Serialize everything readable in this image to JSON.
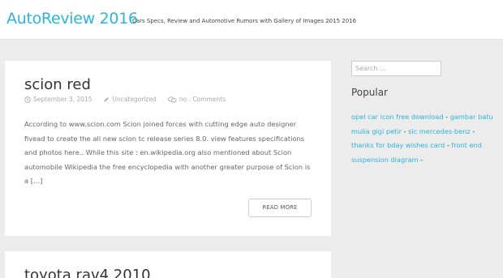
{
  "header": {
    "site_title": "AutoReview 2016",
    "tagline": "Cars Specs, Review and Automotive Rumors with Gallery of Images 2015 2016"
  },
  "posts": [
    {
      "title": "scion red",
      "date": "September 3, 2015",
      "category": "Uncategorized",
      "comments": "no . Comments",
      "excerpt": "According to www.scion.com Scion joined forces with cutting edge auto designer fivead to create the all new scion tc release series 8.0. view features specifications and photos here.. While this site : en.wikipedia.org also mentioned about Scion automobile Wikipedia the free encyclopedia with another greater purpose of Scion is a […]",
      "read_more": "READ MORE"
    },
    {
      "title": "toyota rav4 2010"
    }
  ],
  "sidebar": {
    "search_placeholder": "Search …",
    "popular_title": "Popular",
    "popular_links": [
      "opel car icon free download",
      "gambar batu mulia gigi petir",
      "slc mercedes-benz",
      "thanks for bday wishes card",
      "front end suspension diagram"
    ],
    "separator": "-"
  },
  "colors": {
    "accent": "#2bb5d6",
    "background": "#ececec",
    "card": "#ffffff"
  },
  "icons": [
    "clock-icon",
    "pencil-icon",
    "comment-icon"
  ]
}
